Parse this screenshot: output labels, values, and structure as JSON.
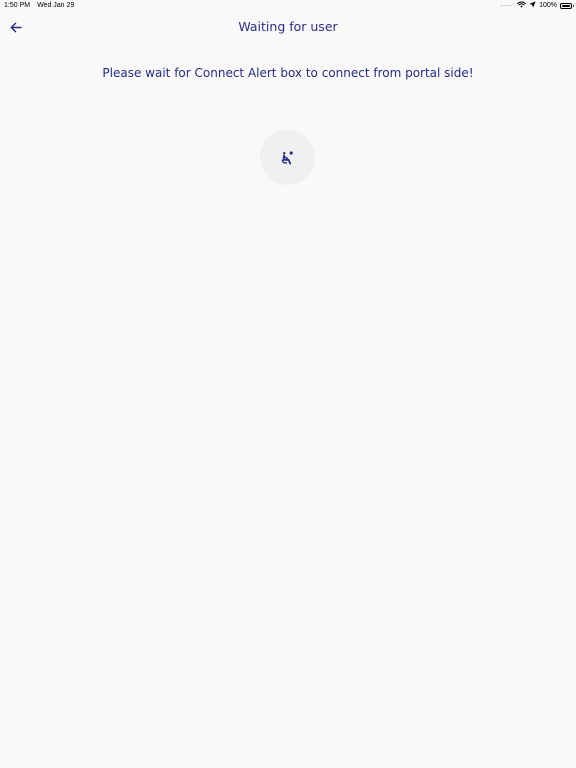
{
  "status_bar": {
    "time": "1:50 PM",
    "date": "Wed Jan 29",
    "battery": "100%",
    "wifi_icon": "wifi-icon",
    "location_icon": "location-arrow-icon",
    "battery_icon": "battery-full-icon"
  },
  "nav": {
    "title": "Waiting for user",
    "back_icon": "arrow-left-icon"
  },
  "main": {
    "message": "Please wait for Connect Alert box to connect from portal side!",
    "status_icon": "seated-person-icon"
  },
  "colors": {
    "accent": "#262b87",
    "background": "#f9f9f9",
    "circle": "#f0f0f0"
  }
}
